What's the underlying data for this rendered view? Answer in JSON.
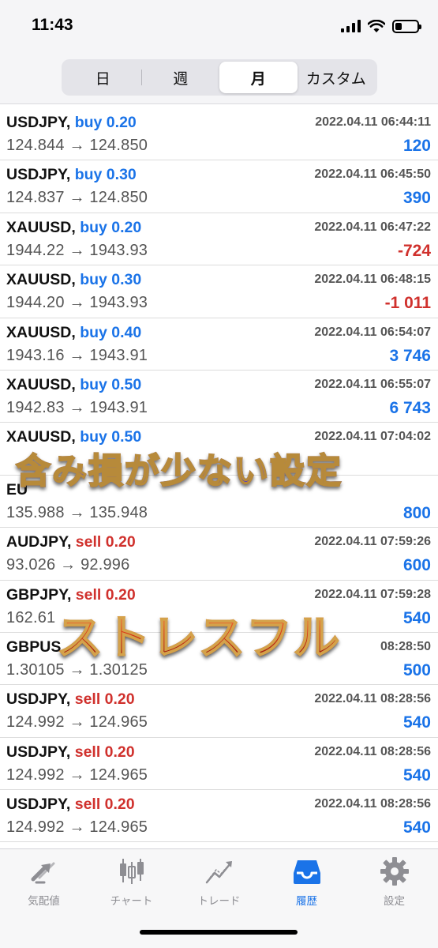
{
  "status_bar": {
    "time": "11:43",
    "battery_level": 0.3
  },
  "segments": [
    {
      "label": "日",
      "active": false
    },
    {
      "label": "週",
      "active": false
    },
    {
      "label": "月",
      "active": true
    },
    {
      "label": "カスタム",
      "active": false
    }
  ],
  "trades": [
    {
      "symbol": "USDJPY,",
      "type": "buy 0.20",
      "side": "buy",
      "time": "2022.04.11 06:44:11",
      "prices": "124.844 → 124.850",
      "profit": "120",
      "profit_sign": "pos"
    },
    {
      "symbol": "USDJPY,",
      "type": "buy 0.30",
      "side": "buy",
      "time": "2022.04.11 06:45:50",
      "prices": "124.837 → 124.850",
      "profit": "390",
      "profit_sign": "pos"
    },
    {
      "symbol": "XAUUSD,",
      "type": "buy 0.20",
      "side": "buy",
      "time": "2022.04.11 06:47:22",
      "prices": "1944.22 → 1943.93",
      "profit": "-724",
      "profit_sign": "neg"
    },
    {
      "symbol": "XAUUSD,",
      "type": "buy 0.30",
      "side": "buy",
      "time": "2022.04.11 06:48:15",
      "prices": "1944.20 → 1943.93",
      "profit": "-1 011",
      "profit_sign": "neg"
    },
    {
      "symbol": "XAUUSD,",
      "type": "buy 0.40",
      "side": "buy",
      "time": "2022.04.11 06:54:07",
      "prices": "1943.16 → 1943.91",
      "profit": "3 746",
      "profit_sign": "pos"
    },
    {
      "symbol": "XAUUSD,",
      "type": "buy 0.50",
      "side": "buy",
      "time": "2022.04.11 06:55:07",
      "prices": "1942.83 → 1943.91",
      "profit": "6 743",
      "profit_sign": "pos"
    },
    {
      "symbol": "XAUUSD,",
      "type": "buy 0.50",
      "side": "buy",
      "time": "2022.04.11 07:04:02",
      "prices": "",
      "profit": "",
      "profit_sign": "pos"
    },
    {
      "symbol": "EU",
      "type": "",
      "side": "sell",
      "time": "",
      "prices": "135.988 → 135.948",
      "profit": "800",
      "profit_sign": "pos"
    },
    {
      "symbol": "AUDJPY,",
      "type": "sell 0.20",
      "side": "sell",
      "time": "2022.04.11 07:59:26",
      "prices": "93.026 → 92.996",
      "profit": "600",
      "profit_sign": "pos"
    },
    {
      "symbol": "GBPJPY,",
      "type": "sell 0.20",
      "side": "sell",
      "time": "2022.04.11 07:59:28",
      "prices": "162.61",
      "profit": "540",
      "profit_sign": "pos"
    },
    {
      "symbol": "GBPUS",
      "type": "",
      "side": "buy",
      "time": "08:28:50",
      "prices": "1.30105 → 1.30125",
      "profit": "500",
      "profit_sign": "pos"
    },
    {
      "symbol": "USDJPY,",
      "type": "sell 0.20",
      "side": "sell",
      "time": "2022.04.11 08:28:56",
      "prices": "124.992 → 124.965",
      "profit": "540",
      "profit_sign": "pos"
    },
    {
      "symbol": "USDJPY,",
      "type": "sell 0.20",
      "side": "sell",
      "time": "2022.04.11 08:28:56",
      "prices": "124.992 → 124.965",
      "profit": "540",
      "profit_sign": "pos"
    },
    {
      "symbol": "USDJPY,",
      "type": "sell 0.20",
      "side": "sell",
      "time": "2022.04.11 08:28:56",
      "prices": "124.992 → 124.965",
      "profit": "540",
      "profit_sign": "pos"
    }
  ],
  "overlay": {
    "line1": "含み損が少ない設定",
    "line2": "ストレスフル"
  },
  "tabs": [
    {
      "label": "気配値",
      "icon": "quotes-icon",
      "active": false
    },
    {
      "label": "チャート",
      "icon": "chart-icon",
      "active": false
    },
    {
      "label": "トレード",
      "icon": "trade-icon",
      "active": false
    },
    {
      "label": "履歴",
      "icon": "history-icon",
      "active": true
    },
    {
      "label": "設定",
      "icon": "settings-icon",
      "active": false
    }
  ],
  "colors": {
    "accent": "#1a73e8",
    "loss": "#d0312d"
  }
}
